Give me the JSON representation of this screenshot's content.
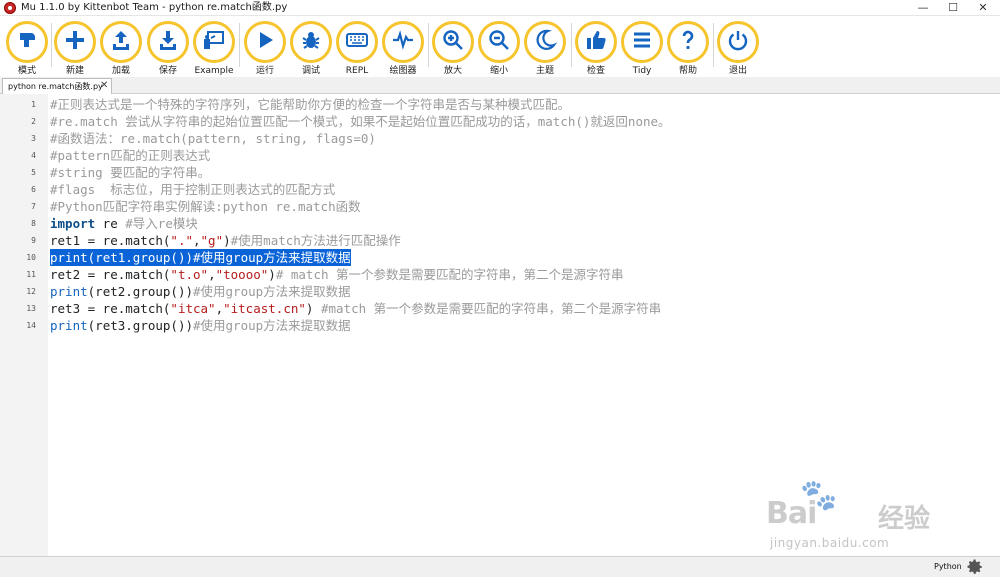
{
  "window": {
    "title": "Mu 1.1.0 by Kittenbot Team - python re.match函数.py",
    "minimize": "—",
    "maximize": "☐",
    "close": "✕"
  },
  "toolbar": [
    {
      "id": "mode",
      "label": "模式",
      "icon": "mode-icon"
    },
    {
      "id": "new",
      "label": "新建",
      "icon": "plus-icon"
    },
    {
      "id": "load",
      "label": "加载",
      "icon": "upload-icon"
    },
    {
      "id": "save",
      "label": "保存",
      "icon": "download-icon"
    },
    {
      "id": "example",
      "label": "Example",
      "icon": "presentation-icon"
    },
    {
      "id": "run",
      "label": "运行",
      "icon": "play-icon"
    },
    {
      "id": "debug",
      "label": "调试",
      "icon": "bug-icon"
    },
    {
      "id": "repl",
      "label": "REPL",
      "icon": "keyboard-icon"
    },
    {
      "id": "plotter",
      "label": "绘图器",
      "icon": "waveform-icon"
    },
    {
      "id": "zoom-in",
      "label": "放大",
      "icon": "zoom-in-icon"
    },
    {
      "id": "zoom-out",
      "label": "缩小",
      "icon": "zoom-out-icon"
    },
    {
      "id": "theme",
      "label": "主题",
      "icon": "moon-icon"
    },
    {
      "id": "check",
      "label": "检查",
      "icon": "thumbs-up-icon"
    },
    {
      "id": "tidy",
      "label": "Tidy",
      "icon": "lines-icon"
    },
    {
      "id": "help",
      "label": "帮助",
      "icon": "question-icon"
    },
    {
      "id": "quit",
      "label": "退出",
      "icon": "power-icon"
    }
  ],
  "tab": {
    "label": "python re.match函数.py",
    "close": "✕"
  },
  "editor": {
    "line_numbers": [
      "1",
      "2",
      "3",
      "4",
      "5",
      "6",
      "7",
      "8",
      "9",
      "10",
      "11",
      "12",
      "13",
      "14"
    ],
    "lines": [
      [
        {
          "t": "#正则表达式是一个特殊的字符序列，它能帮助你方便的检查一个字符串是否与某种模式匹配。",
          "c": "com"
        }
      ],
      [
        {
          "t": "#re.match 尝试从字符串的起始位置匹配一个模式，如果不是起始位置匹配成功的话，match()就返回none。",
          "c": "com"
        }
      ],
      [
        {
          "t": "#函数语法：re.match(pattern, string, flags=0)",
          "c": "com"
        }
      ],
      [
        {
          "t": "#pattern匹配的正则表达式",
          "c": "com"
        }
      ],
      [
        {
          "t": "#string 要匹配的字符串。",
          "c": "com"
        }
      ],
      [
        {
          "t": "#flags  标志位，用于控制正则表达式的匹配方式",
          "c": "com"
        }
      ],
      [
        {
          "t": "#Python匹配字符串实例解读:python re.match函数",
          "c": "com"
        }
      ],
      [
        {
          "t": "import",
          "c": "kw"
        },
        {
          "t": " re ",
          "c": "txt"
        },
        {
          "t": "#导入re模块",
          "c": "com"
        }
      ],
      [
        {
          "t": "ret1 = re.match(",
          "c": "txt"
        },
        {
          "t": "\".\"",
          "c": "str"
        },
        {
          "t": ",",
          "c": "txt"
        },
        {
          "t": "\"g\"",
          "c": "str"
        },
        {
          "t": ")",
          "c": "txt"
        },
        {
          "t": "#使用match方法进行匹配操作",
          "c": "com"
        }
      ],
      [
        {
          "t": "print",
          "c": "fn"
        },
        {
          "t": "(ret1.group())",
          "c": "txt"
        },
        {
          "t": "#使用group方法来提取数据",
          "c": "com"
        }
      ],
      [
        {
          "t": "ret2 = re.match(",
          "c": "txt"
        },
        {
          "t": "\"t.o\"",
          "c": "str"
        },
        {
          "t": ",",
          "c": "txt"
        },
        {
          "t": "\"toooo\"",
          "c": "str"
        },
        {
          "t": ")",
          "c": "txt"
        },
        {
          "t": "# match 第一个参数是需要匹配的字符串，第二个是源字符串",
          "c": "com"
        }
      ],
      [
        {
          "t": "print",
          "c": "fn"
        },
        {
          "t": "(ret2.group())",
          "c": "txt"
        },
        {
          "t": "#使用group方法来提取数据",
          "c": "com"
        }
      ],
      [
        {
          "t": "ret3 = re.match(",
          "c": "txt"
        },
        {
          "t": "\"itca\"",
          "c": "str"
        },
        {
          "t": ",",
          "c": "txt"
        },
        {
          "t": "\"itcast.cn\"",
          "c": "str"
        },
        {
          "t": ") ",
          "c": "txt"
        },
        {
          "t": "#match 第一个参数是需要匹配的字符串，第二个是源字符串",
          "c": "com"
        }
      ],
      [
        {
          "t": "print",
          "c": "fn"
        },
        {
          "t": "(ret3.group())",
          "c": "txt"
        },
        {
          "t": "#使用group方法来提取数据",
          "c": "com"
        }
      ]
    ],
    "selected_line": 10
  },
  "watermark": {
    "brand_latin": "Bai",
    "brand_cn": "经验",
    "url": "jingyan.baidu.com"
  },
  "status": {
    "mode": "Python",
    "settings_icon": "gear-icon"
  },
  "colors": {
    "accent": "#f6c42c",
    "selection": "#0a64d8",
    "keyword": "#0d4f8b",
    "string": "#b71c1c",
    "comment": "#9a9a9a"
  }
}
